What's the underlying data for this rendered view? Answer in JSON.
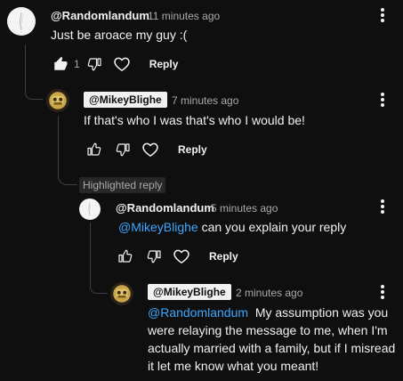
{
  "comments": [
    {
      "author": "@Randomlandum",
      "time": "11 minutes ago",
      "text": "Just be aroace my guy :(",
      "like_count": "1",
      "reply_label": "Reply"
    },
    {
      "author": "@MikeyBlighe",
      "time": "7 minutes ago",
      "text": "If that's who I was that's who I would be!",
      "reply_label": "Reply"
    },
    {
      "author": "@Randomlandum",
      "time": "5 minutes ago",
      "mention": "@MikeyBlighe",
      "text": " can you explain your reply",
      "reply_label": "Reply"
    },
    {
      "author": "@MikeyBlighe",
      "time": "2 minutes ago",
      "mention": "@Randomlandum",
      "text_line1": "  My assumption was you",
      "text_line2": "were relaying the message to me, when I'm",
      "text_line3": "actually married with a family, but if I misread",
      "text_line4": "it let me know what you meant!"
    }
  ],
  "highlighted_label": "Highlighted reply",
  "colors": {
    "background": "#0f0f0f",
    "text": "#f1f1f1",
    "muted": "#aaaaaa",
    "mention": "#3ea6ff",
    "chip": "#f1f1f1",
    "badge": "#272727"
  }
}
